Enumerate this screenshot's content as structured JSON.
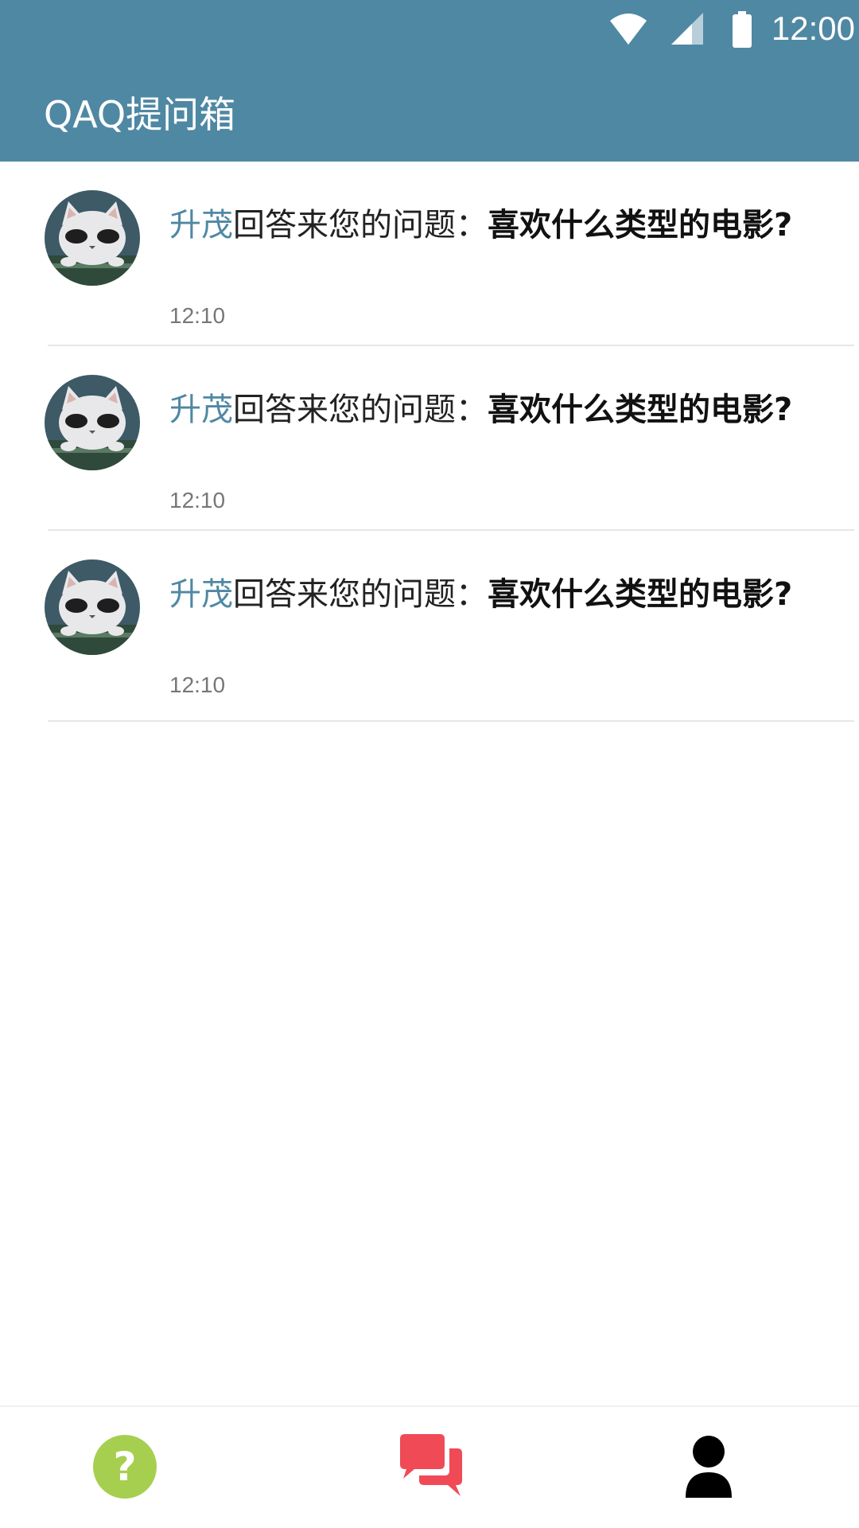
{
  "status_bar": {
    "time": "12:00",
    "icons": [
      "wifi-icon",
      "signal-icon",
      "battery-icon"
    ]
  },
  "app_bar": {
    "title": "QAQ提问箱",
    "color": "#4f88a3"
  },
  "notifications": [
    {
      "user": "升茂",
      "action": "回答来您的问题：",
      "question": "喜欢什么类型的电影?",
      "time": "12:10"
    },
    {
      "user": "升茂",
      "action": "回答来您的问题：",
      "question": "喜欢什么类型的电影?",
      "time": "12:10"
    },
    {
      "user": "升茂",
      "action": "回答来您的问题：",
      "question": "喜欢什么类型的电影?",
      "time": "12:10"
    }
  ],
  "bottom_nav": [
    {
      "icon": "question-icon",
      "color": "#a6cf4f"
    },
    {
      "icon": "chat-bubbles-icon",
      "color": "#f04a56",
      "active": true
    },
    {
      "icon": "person-icon",
      "color": "#000000"
    }
  ]
}
